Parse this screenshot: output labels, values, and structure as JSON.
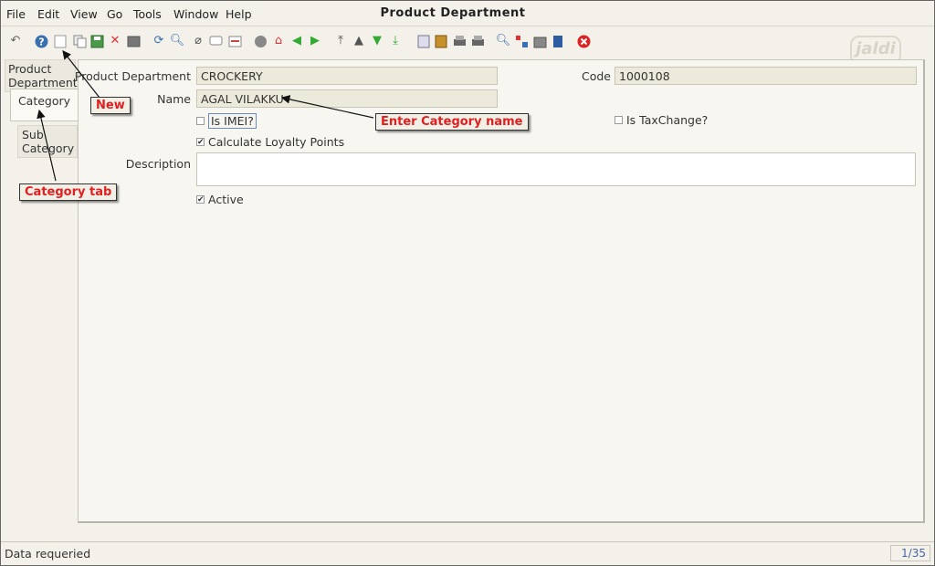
{
  "menu": {
    "file": "File",
    "edit": "Edit",
    "view": "View",
    "go": "Go",
    "tools": "Tools",
    "window": "Window",
    "help": "Help"
  },
  "window_title": "Product Department",
  "logo_text": "jaldi",
  "toolbar": {
    "icons": [
      "undo-icon",
      "help-icon",
      "new-icon",
      "copy-icon",
      "save-icon",
      "delete-icon",
      "print-preview-icon",
      "refresh-icon",
      "find-icon",
      "attachment-icon",
      "chat-icon",
      "history-icon",
      "archive-icon",
      "home-icon",
      "back-icon",
      "forward-icon",
      "first-icon",
      "previous-icon",
      "next-icon",
      "last-icon",
      "report-icon",
      "archive-viewer-icon",
      "print-icon",
      "print2-icon",
      "zoom-icon",
      "workflow-icon",
      "product-info-icon",
      "request-icon",
      "close-icon"
    ]
  },
  "tabs": {
    "product_department": "Product Department",
    "category": "Category",
    "sub_category": "Sub Category"
  },
  "form": {
    "product_department_label": "Product Department",
    "product_department_value": "CROCKERY",
    "code_label": "Code",
    "code_value": "1000108",
    "name_label": "Name",
    "name_value": "AGAL VILAKKU",
    "is_imei_label": "Is IMEI?",
    "is_imei_checked": false,
    "is_taxchange_label": "Is TaxChange?",
    "is_taxchange_checked": false,
    "calculate_loyalty_label": "Calculate Loyalty Points",
    "calculate_loyalty_checked": true,
    "description_label": "Description",
    "description_value": "",
    "active_label": "Active",
    "active_checked": true
  },
  "annotations": {
    "new": "New",
    "enter_category": "Enter Category name",
    "category_tab": "Category tab"
  },
  "status": {
    "text": "Data requeried",
    "record": "1/35"
  },
  "colors": {
    "callout_text": "#e02020",
    "field_bg": "#eceadb",
    "panel_bg": "#f7f6f0"
  }
}
